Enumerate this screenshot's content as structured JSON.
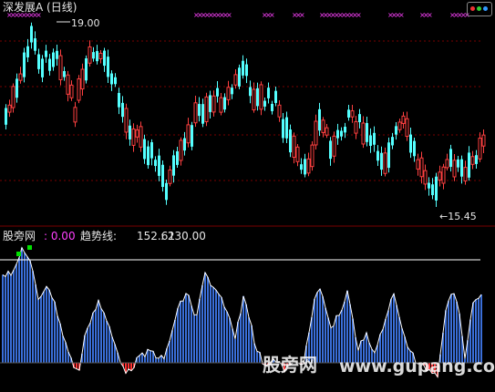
{
  "header": {
    "title": "深发展A  (日线)"
  },
  "price_panel": {
    "high_annotation": "19.00",
    "low_annotation": "15.45",
    "candle_up_color": "#ff4040",
    "candle_down_color": "#54ffff",
    "signal_marker_color": "#ff40ff"
  },
  "indicator_panel": {
    "name": "股旁网",
    "value": ": 0.00",
    "trend_label": "趋势线:",
    "trend_value": "152.61",
    "level_label": ": 230.00",
    "bar_color": "#3a6ed8",
    "negative_color": "#ff3030",
    "line_color": "#ffffff",
    "signal_color": "#00e000"
  },
  "watermark": {
    "cn": "股旁网",
    "en": "www.gupang.com"
  },
  "logo": {
    "icon": "colored-dots-logo-icon"
  }
}
